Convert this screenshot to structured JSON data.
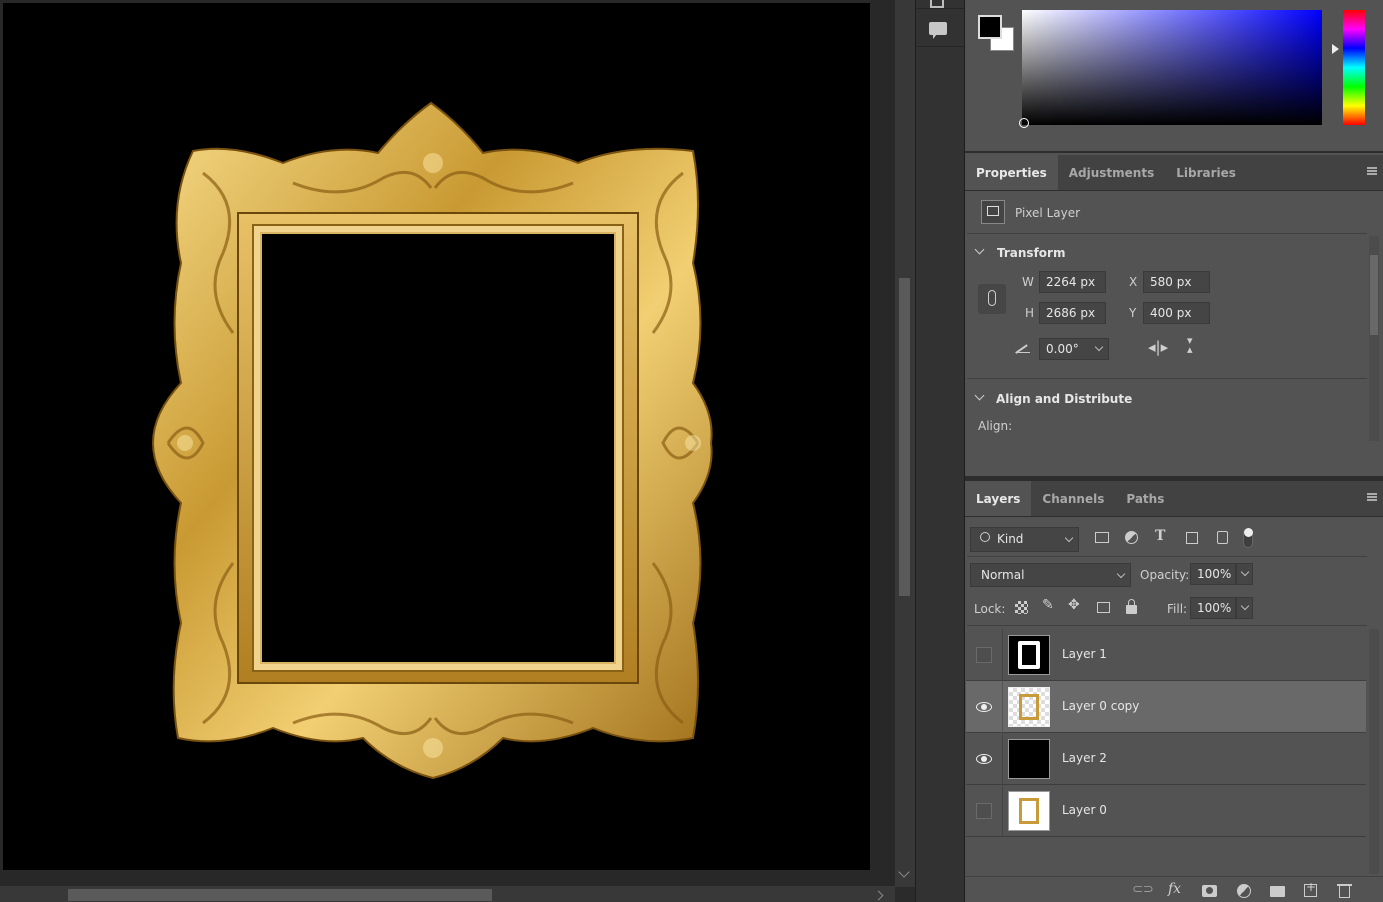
{
  "color": {
    "foreground": "#000000",
    "background": "#ffffff",
    "picker_hue": "#0000ff"
  },
  "properties_tabs": [
    {
      "label": "Properties",
      "active": true
    },
    {
      "label": "Adjustments",
      "active": false
    },
    {
      "label": "Libraries",
      "active": false
    }
  ],
  "properties": {
    "layer_kind": "Pixel Layer",
    "transform_title": "Transform",
    "w_label": "W",
    "w_value": "2264 px",
    "h_label": "H",
    "h_value": "2686 px",
    "x_label": "X",
    "x_value": "580 px",
    "y_label": "Y",
    "y_value": "400 px",
    "angle_value": "0.00°",
    "align_title": "Align and Distribute",
    "align_label": "Align:"
  },
  "layers_tabs": [
    {
      "label": "Layers",
      "active": true
    },
    {
      "label": "Channels",
      "active": false
    },
    {
      "label": "Paths",
      "active": false
    }
  ],
  "layers": {
    "filter_kind": "Kind",
    "blend_mode": "Normal",
    "opacity_label": "Opacity:",
    "opacity_value": "100%",
    "lock_label": "Lock:",
    "fill_label": "Fill:",
    "fill_value": "100%",
    "items": [
      {
        "name": "Layer 1",
        "visible": false,
        "selected": false,
        "thumb": "mask"
      },
      {
        "name": "Layer 0 copy",
        "visible": true,
        "selected": true,
        "thumb": "frame-transparent"
      },
      {
        "name": "Layer 2",
        "visible": true,
        "selected": false,
        "thumb": "black"
      },
      {
        "name": "Layer 0",
        "visible": false,
        "selected": false,
        "thumb": "frame-white"
      }
    ]
  }
}
